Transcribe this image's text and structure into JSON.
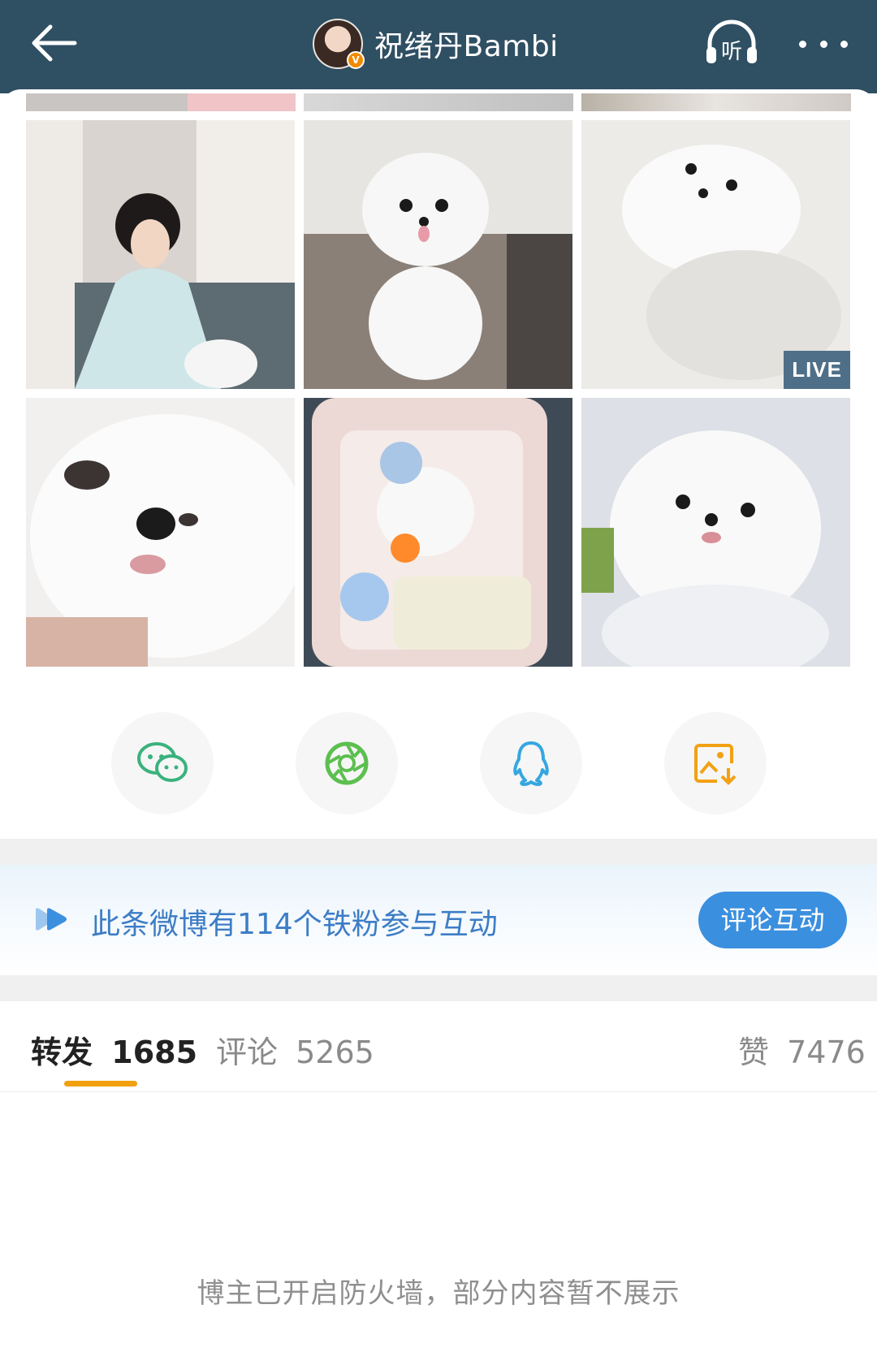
{
  "header": {
    "title": "祝绪丹Bambi",
    "verified_badge": "V",
    "back_icon": "arrow-left-icon",
    "listen_label": "听",
    "more_icon": "more-dots-icon"
  },
  "photos": {
    "live_label": "LIVE"
  },
  "share": {
    "targets": [
      "wechat-icon",
      "moments-icon",
      "qq-icon",
      "save-image-icon"
    ]
  },
  "fans_banner": {
    "text": "此条微博有114个铁粉参与互动",
    "button": "评论互动"
  },
  "tabs": {
    "repost_label": "转发",
    "repost_count": "1685",
    "comment_label": "评论",
    "comment_count": "5265",
    "like_label": "赞",
    "like_count": "7476"
  },
  "notice": "博主已开启防火墙，部分内容暂不展示",
  "colors": {
    "header_bg": "#2f4f63",
    "accent_blue": "#3b8fdf",
    "tab_underline": "#f1a010"
  }
}
